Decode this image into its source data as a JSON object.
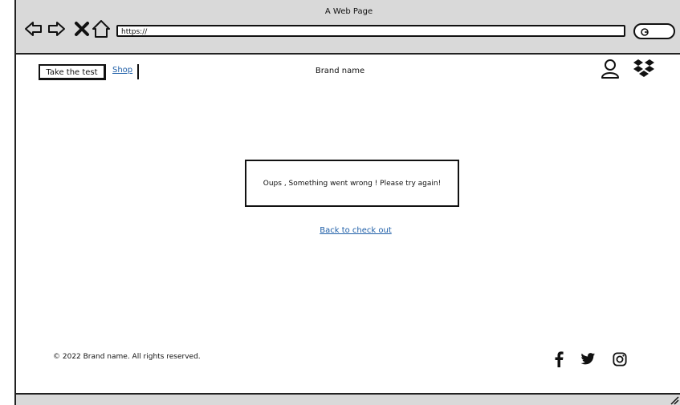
{
  "window": {
    "title": "A Web Page"
  },
  "browser": {
    "url": "https://"
  },
  "header": {
    "take_test_label": "Take the test",
    "shop_label": "Shop",
    "brand": "Brand name"
  },
  "main": {
    "error_message": "Oups , Something went wrong ! Please try again!",
    "back_link": "Back to check out"
  },
  "footer": {
    "copyright": "© 2022 Brand name. All rights reserved.",
    "social_icons": [
      "facebook-icon",
      "twitter-icon",
      "instagram-icon"
    ]
  },
  "colors": {
    "chrome": "#d9d9d9",
    "link": "#1f5fa8"
  }
}
